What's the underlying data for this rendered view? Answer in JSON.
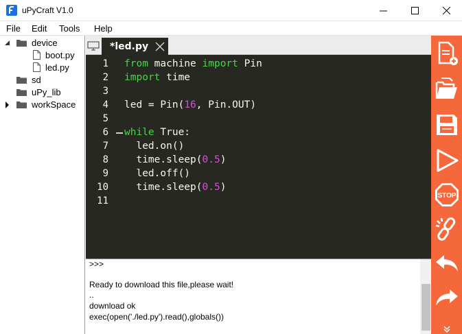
{
  "window": {
    "title": "uPyCraft V1.0"
  },
  "menu": {
    "items": [
      "File",
      "Edit",
      "Tools",
      "Help"
    ]
  },
  "tree": {
    "device": "device",
    "boot": "boot.py",
    "led": "led.py",
    "sd": "sd",
    "upy_lib": "uPy_lib",
    "workspace": "workSpace"
  },
  "editor": {
    "tab_label": "*led.py",
    "line_numbers": [
      "1",
      "2",
      "3",
      "4",
      "5",
      "6",
      "7",
      "8",
      "9",
      "10",
      "11"
    ],
    "lines": [
      {
        "pre": "",
        "kw": "from",
        "mid": " machine ",
        "kw2": "import",
        "post": " Pin"
      },
      {
        "pre": "",
        "kw": "import",
        "mid": " time",
        "kw2": "",
        "post": ""
      },
      {
        "pre": "",
        "kw": "",
        "mid": "",
        "kw2": "",
        "post": ""
      },
      {
        "pre": "led = Pin(",
        "num": "16",
        "post": ", Pin.OUT)"
      },
      {
        "pre": "",
        "kw": "",
        "mid": "",
        "kw2": "",
        "post": ""
      },
      {
        "pre": "",
        "kw": "while",
        "mid": " True:",
        "kw2": "",
        "post": ""
      },
      {
        "pre": "  led.on()"
      },
      {
        "pre": "  time.sleep(",
        "num": "0.5",
        "post": ")"
      },
      {
        "pre": "  led.off()"
      },
      {
        "pre": "  time.sleep(",
        "num": "0.5",
        "post": ")"
      },
      {
        "pre": ""
      }
    ]
  },
  "terminal": {
    "lines": [
      ">>>",
      "",
      "Ready to download this file,please wait!",
      "..",
      "download ok",
      "exec(open('./led.py').read(),globals())"
    ]
  },
  "colors": {
    "toolbar": "#f4683c",
    "editor_bg": "#272822",
    "keyword": "#48d648",
    "number": "#d64ed6"
  },
  "toolbar_icons": [
    "new-file-icon",
    "open-folder-icon",
    "save-icon",
    "download-run-icon",
    "stop-icon",
    "connect-icon",
    "undo-icon",
    "redo-icon"
  ]
}
